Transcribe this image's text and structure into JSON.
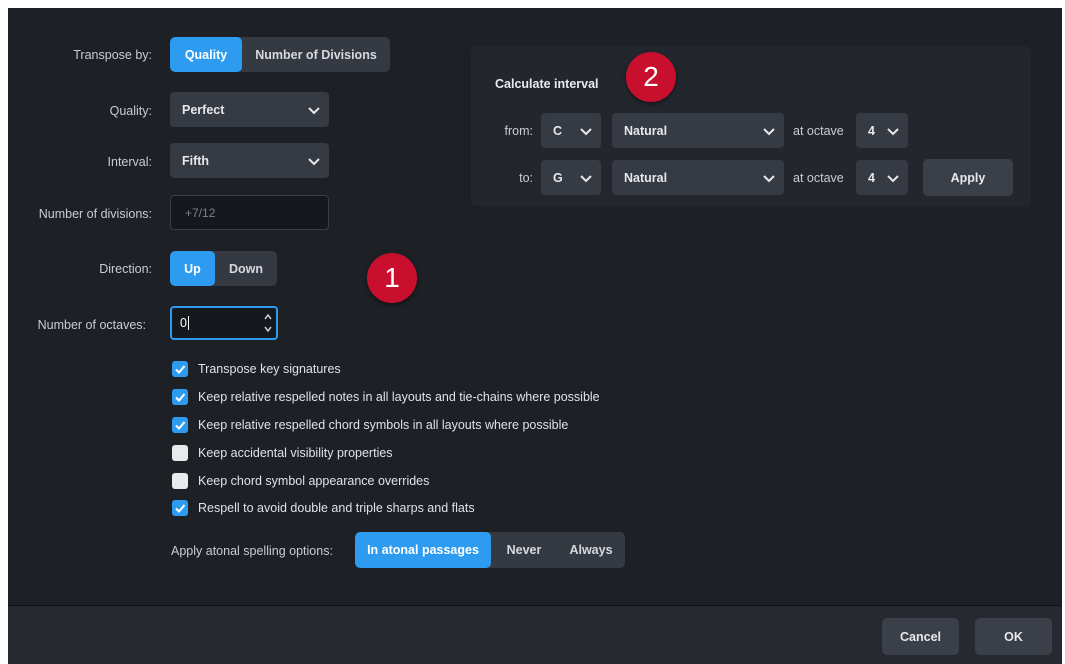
{
  "transpose_by": {
    "label": "Transpose by:",
    "options": [
      "Quality",
      "Number of Divisions"
    ],
    "selected": "Quality"
  },
  "quality": {
    "label": "Quality:",
    "value": "Perfect",
    "icon": "chevron-down-icon"
  },
  "interval": {
    "label": "Interval:",
    "value": "Fifth",
    "icon": "chevron-down-icon"
  },
  "divisions": {
    "label": "Number of divisions:",
    "value": "+7/12"
  },
  "direction": {
    "label": "Direction:",
    "options": [
      "Up",
      "Down"
    ],
    "selected": "Up"
  },
  "octaves": {
    "label": "Number of octaves:",
    "value": "0"
  },
  "checkboxes": [
    {
      "label": "Transpose key signatures",
      "checked": true
    },
    {
      "label": "Keep relative respelled notes in all layouts and tie-chains where possible",
      "checked": true
    },
    {
      "label": "Keep relative respelled chord symbols in all layouts where possible",
      "checked": true
    },
    {
      "label": "Keep accidental visibility properties",
      "checked": false
    },
    {
      "label": "Keep chord symbol appearance overrides",
      "checked": false
    },
    {
      "label": "Respell to avoid double and triple sharps and flats",
      "checked": true
    }
  ],
  "atonal": {
    "label": "Apply atonal spelling options:",
    "options": [
      "In atonal passages",
      "Never",
      "Always"
    ],
    "selected": "In atonal passages"
  },
  "calculate": {
    "title": "Calculate interval",
    "from": {
      "label": "from:",
      "note": "C",
      "accidental": "Natural",
      "octave_label": "at octave",
      "octave": "4"
    },
    "to": {
      "label": "to:",
      "note": "G",
      "accidental": "Natural",
      "octave_label": "at octave",
      "octave": "4"
    },
    "apply_label": "Apply"
  },
  "footer": {
    "cancel_label": "Cancel",
    "ok_label": "OK"
  },
  "badges": [
    "1",
    "2"
  ],
  "colors": {
    "accent": "#2d9cf0",
    "dialog_bg": "#1d2126",
    "badge": "#c8102e",
    "checkbox_off": "#e8eaed"
  }
}
